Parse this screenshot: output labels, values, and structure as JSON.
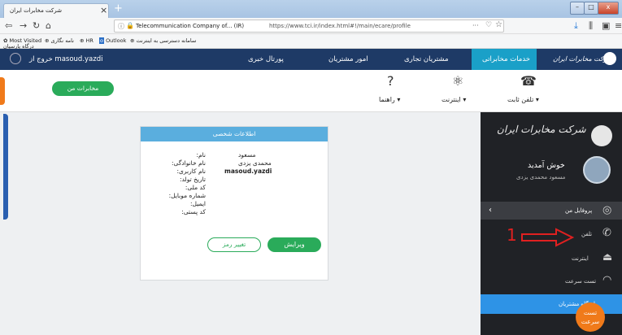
{
  "browser": {
    "tab_title": "شرکت مخابرات ایران",
    "tab_close": "×",
    "new_tab": "+",
    "window_controls": [
      "–",
      "□",
      "x"
    ],
    "url_org": "Telecommunication Company of... (IR)",
    "url": "https://www.tci.ir/index.html#!/main/ecare/profile",
    "nav_more": "···",
    "bookmarks": [
      "Most Visited",
      "نامه نگاری",
      "HR",
      "Outlook",
      "سامانه دسترسی به اینترنت",
      "درگاه پارسیان"
    ]
  },
  "site": {
    "logo_text": "شرکت مخابرات ایران",
    "nav": [
      "خدمات مخابراتی",
      "مشتریان تجاری",
      "امور مشتریان",
      "پورتال خبری"
    ],
    "user_label": "خروج از masoud.yazdi"
  },
  "subheader": {
    "my_telecom": "مخابرات من",
    "menu": [
      "تلفن ثابت ▾",
      "اینترنت ▾",
      "راهنما ▾"
    ]
  },
  "card": {
    "title": "اطلاعات شخصی",
    "labels": [
      "نام:",
      "نام خانوادگی:",
      "نام کاربری:",
      "تاریخ تولد:",
      "کد ملی:",
      "شماره موبایل:",
      "ایمیل:",
      "کد پستی:"
    ],
    "values": [
      "مسعود",
      "محمدی یزدی",
      "masoud.yazdi"
    ],
    "edit_label": "ویرایش",
    "pwd_label": "تغییر رمز"
  },
  "panel": {
    "logo_text": "شرکت مخابرات ایران",
    "welcome": "خوش آمدید",
    "username": "مسعود محمدی یزدی",
    "items": [
      "پروفایل من",
      "تلفن",
      "اینترنت",
      "تست سرعت",
      "باشگاه مشتریان"
    ],
    "fast_label": "تست سرعت"
  },
  "annotation": {
    "number": "1"
  }
}
